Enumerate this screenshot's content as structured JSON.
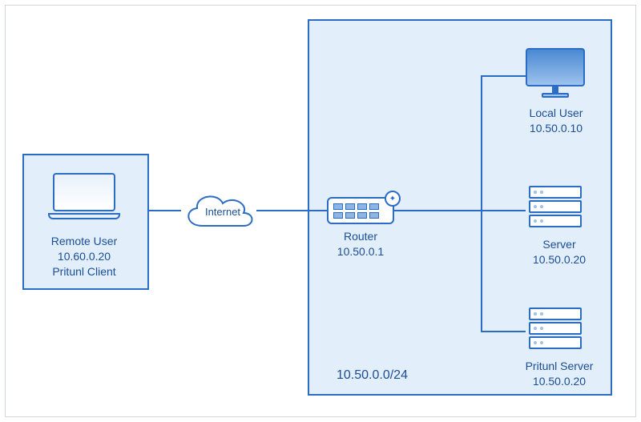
{
  "diagram": {
    "remote_user": {
      "label1": "Remote User",
      "label2": "10.60.0.20",
      "label3": "Pritunl Client"
    },
    "internet": {
      "label": "Internet"
    },
    "router": {
      "label1": "Router",
      "label2": "10.50.0.1"
    },
    "local_user": {
      "label1": "Local User",
      "label2": "10.50.0.10"
    },
    "server": {
      "label1": "Server",
      "label2": "10.50.0.20"
    },
    "pritunl_server": {
      "label1": "Pritunl Server",
      "label2": "10.50.0.20"
    },
    "subnet": "10.50.0.0/24"
  }
}
